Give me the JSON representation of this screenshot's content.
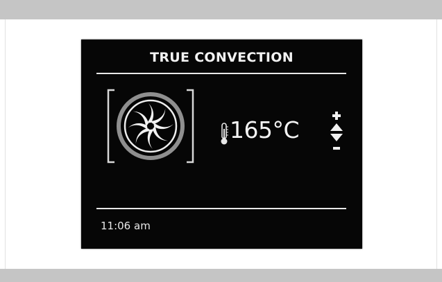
{
  "display": {
    "mode_title": "TRUE CONVECTION",
    "mode_icon": "convection-fan-icon",
    "temperature": {
      "value": "165°C",
      "icon": "thermometer-icon"
    },
    "adjust": {
      "increase_icon": "plus-icon",
      "up_icon": "triangle-up-icon",
      "down_icon": "triangle-down-icon",
      "decrease_icon": "minus-icon"
    },
    "clock": "11:06 am"
  },
  "colors": {
    "screen_background": "#060606",
    "screen_foreground": "#f0f0f0",
    "fan_ring": "#9a9a9a",
    "frame_bars": "#c5c5c5"
  }
}
